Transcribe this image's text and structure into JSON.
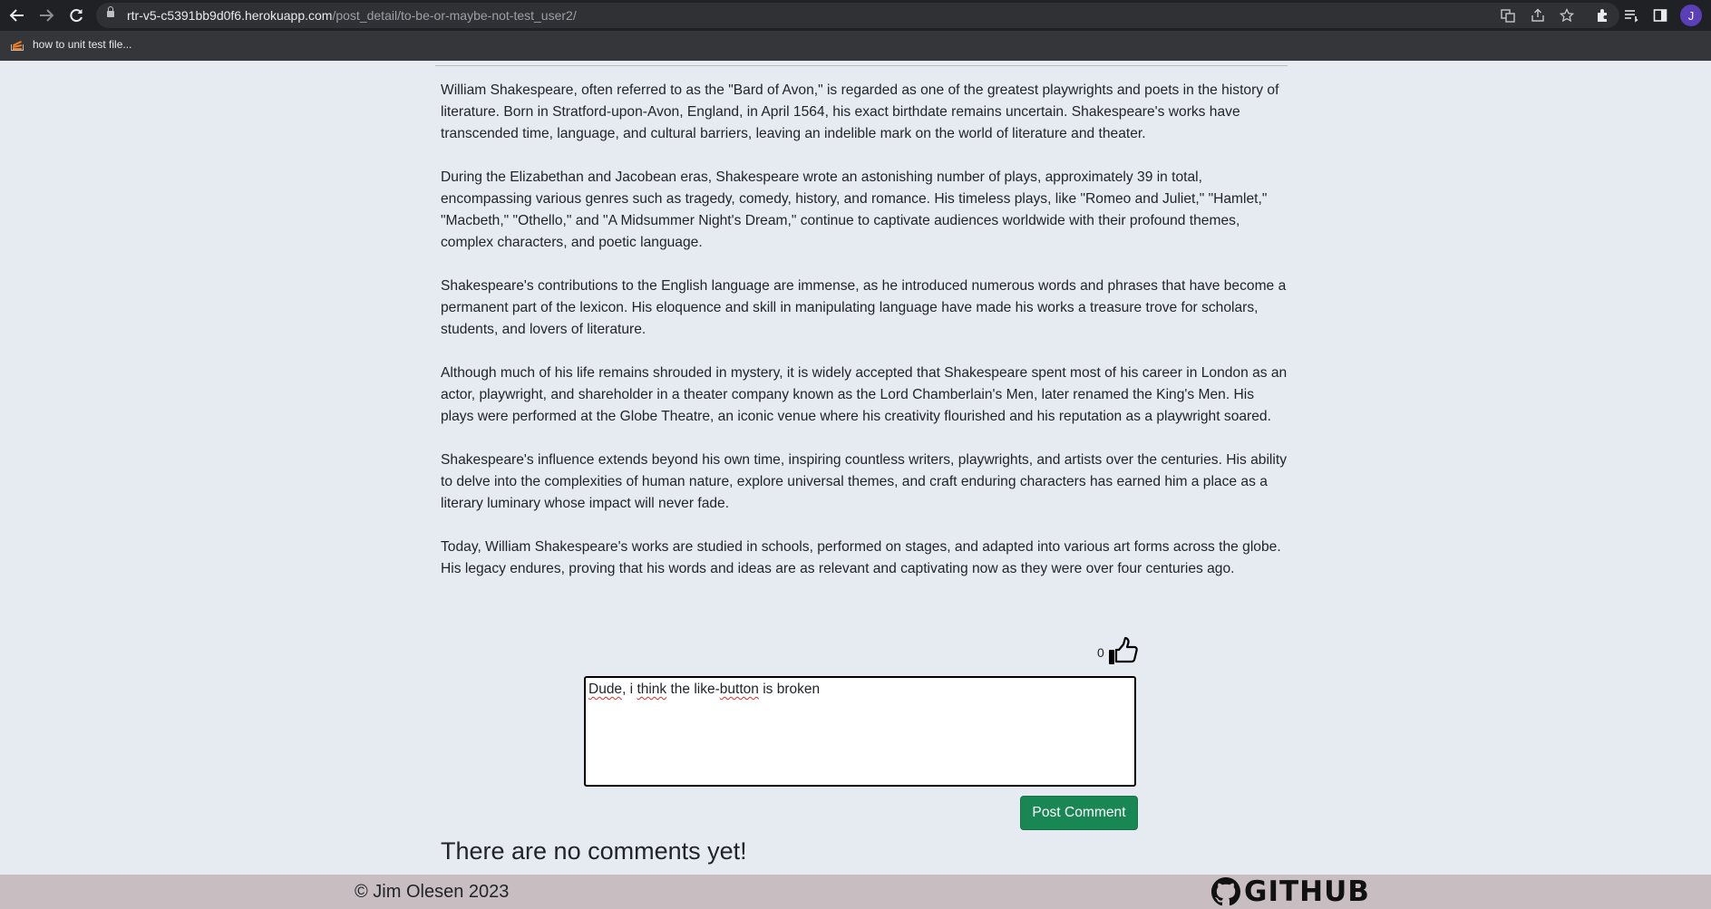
{
  "browser": {
    "url_host": "rtr-v5-c5391bb9d0f6.herokuapp.com",
    "url_path": "/post_detail/to-be-or-maybe-not-test_user2/",
    "bookmark_label": "how to unit test file...",
    "profile_initial": "J"
  },
  "article": {
    "paragraphs": [
      "William Shakespeare, often referred to as the \"Bard of Avon,\" is regarded as one of the greatest playwrights and poets in the history of literature. Born in Stratford-upon-Avon, England, in April 1564, his exact birthdate remains uncertain. Shakespeare's works have transcended time, language, and cultural barriers, leaving an indelible mark on the world of literature and theater.",
      "During the Elizabethan and Jacobean eras, Shakespeare wrote an astonishing number of plays, approximately 39 in total, encompassing various genres such as tragedy, comedy, history, and romance. His timeless plays, like \"Romeo and Juliet,\" \"Hamlet,\" \"Macbeth,\" \"Othello,\" and \"A Midsummer Night's Dream,\" continue to captivate audiences worldwide with their profound themes, complex characters, and poetic language.",
      "Shakespeare's contributions to the English language are immense, as he introduced numerous words and phrases that have become a permanent part of the lexicon. His eloquence and skill in manipulating language have made his works a treasure trove for scholars, students, and lovers of literature.",
      "Although much of his life remains shrouded in mystery, it is widely accepted that Shakespeare spent most of his career in London as an actor, playwright, and shareholder in a theater company known as the Lord Chamberlain's Men, later renamed the King's Men. His plays were performed at the Globe Theatre, an iconic venue where his creativity flourished and his reputation as a playwright soared.",
      "Shakespeare's influence extends beyond his own time, inspiring countless writers, playwrights, and artists over the centuries. His ability to delve into the complexities of human nature, explore universal themes, and craft enduring characters has earned him a place as a literary luminary whose impact will never fade.",
      "Today, William Shakespeare's works are studied in schools, performed on stages, and adapted into various art forms across the globe. His legacy endures, proving that his words and ideas are as relevant and captivating now as they were over four centuries ago."
    ]
  },
  "likes": {
    "count": "0"
  },
  "comment_form": {
    "text_parts": [
      "Dude",
      ", i ",
      "think",
      " the like-",
      "button",
      " is broken"
    ],
    "submit_label": "Post Comment"
  },
  "comments": {
    "empty_message": "There are no comments yet!"
  },
  "footer": {
    "copyright": "© Jim Olesen 2023",
    "github_label": "GITHUB"
  },
  "icons": {
    "back": "arrow-left-icon",
    "forward": "arrow-right-icon",
    "reload": "reload-icon",
    "like": "thumbs-up-icon",
    "github": "github-icon"
  }
}
